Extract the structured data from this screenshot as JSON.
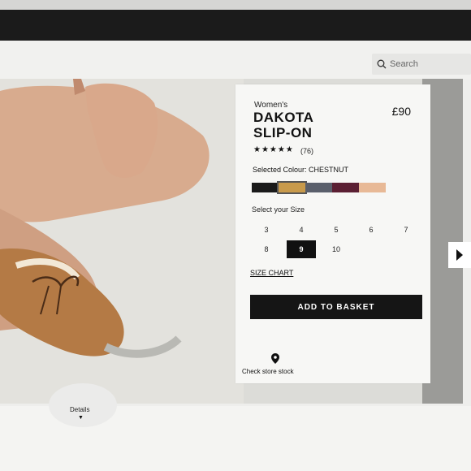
{
  "search": {
    "placeholder": "Search"
  },
  "product": {
    "category": "Women's",
    "name_line1": "DAKOTA",
    "name_line2": "SLIP-ON",
    "price": "£90",
    "rating_stars": "★★★★★",
    "rating": 5,
    "review_count": "(76)",
    "selected_colour_label": "Selected Colour: CHESTNUT",
    "colours": [
      "#1a1a1a",
      "#c89a4b",
      "#5a5f6b",
      "#5b1f33",
      "#e8b996"
    ],
    "selected_colour_index": 1,
    "size_label": "Select your Size",
    "sizes": [
      "3",
      "4",
      "5",
      "6",
      "7",
      "8",
      "9",
      "10"
    ],
    "selected_size": "9",
    "size_chart": "SIZE CHART",
    "add_to_basket": "ADD TO BASKET",
    "store_stock": "Check store stock"
  },
  "details": {
    "label": "Details"
  },
  "icons": {
    "search": "search-icon",
    "pin": "location-pin-icon",
    "next": "chevron-right-icon",
    "details_caret": "caret-down-icon"
  }
}
